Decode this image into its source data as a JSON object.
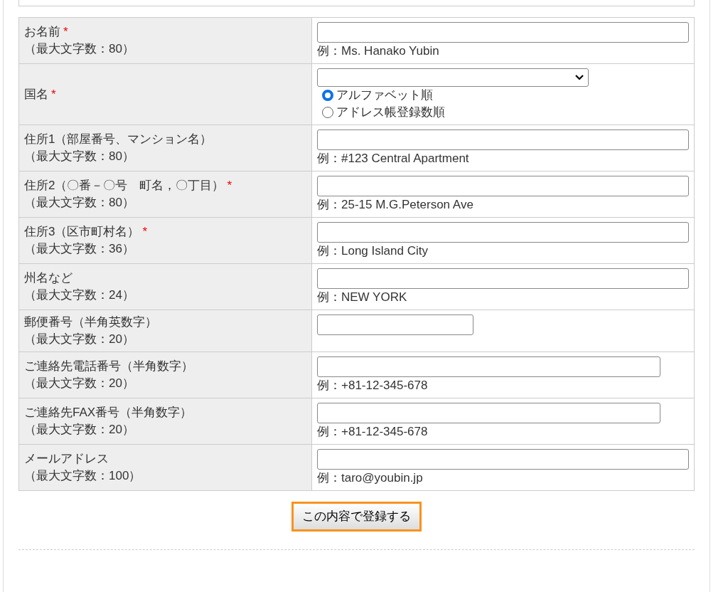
{
  "form": {
    "rows": [
      {
        "kind": "wide",
        "label": "お名前",
        "required_mark": "*",
        "note": "（最大文字数：80）",
        "example": "例：Ms. Hanako Yubin"
      },
      {
        "kind": "select",
        "label": "国名",
        "required_mark": "*",
        "options": [
          {
            "label": "アルファベット順",
            "selected": true
          },
          {
            "label": "アドレス帳登録数順",
            "selected": false
          }
        ]
      },
      {
        "kind": "wide",
        "label": "住所1（部屋番号、マンション名）",
        "note": "（最大文字数：80）",
        "example": "例：#123 Central Apartment"
      },
      {
        "kind": "wide",
        "label": "住所2（〇番－〇号　町名，〇丁目）",
        "required_mark": "*",
        "note": "（最大文字数：80）",
        "example": "例：25-15 M.G.Peterson Ave"
      },
      {
        "kind": "wide",
        "label": "住所3（区市町村名）",
        "required_mark": "*",
        "note": "（最大文字数：36）",
        "example": "例：Long Island City"
      },
      {
        "kind": "wide",
        "label": "州名など",
        "note": "（最大文字数：24）",
        "example": "例：NEW YORK"
      },
      {
        "kind": "short",
        "label": "郵便番号（半角英数字）",
        "note": "（最大文字数：20）"
      },
      {
        "kind": "medium",
        "label": "ご連絡先電話番号（半角数字）",
        "note": "（最大文字数：20）",
        "example": "例：+81-12-345-678"
      },
      {
        "kind": "medium",
        "label": "ご連絡先FAX番号（半角数字）",
        "note": "（最大文字数：20）",
        "example": "例：+81-12-345-678"
      },
      {
        "kind": "wide",
        "label": "メールアドレス",
        "note": "（最大文字数：100）",
        "example": "例：taro@youbin.jp"
      }
    ]
  },
  "submit_button": "この内容で登録する"
}
